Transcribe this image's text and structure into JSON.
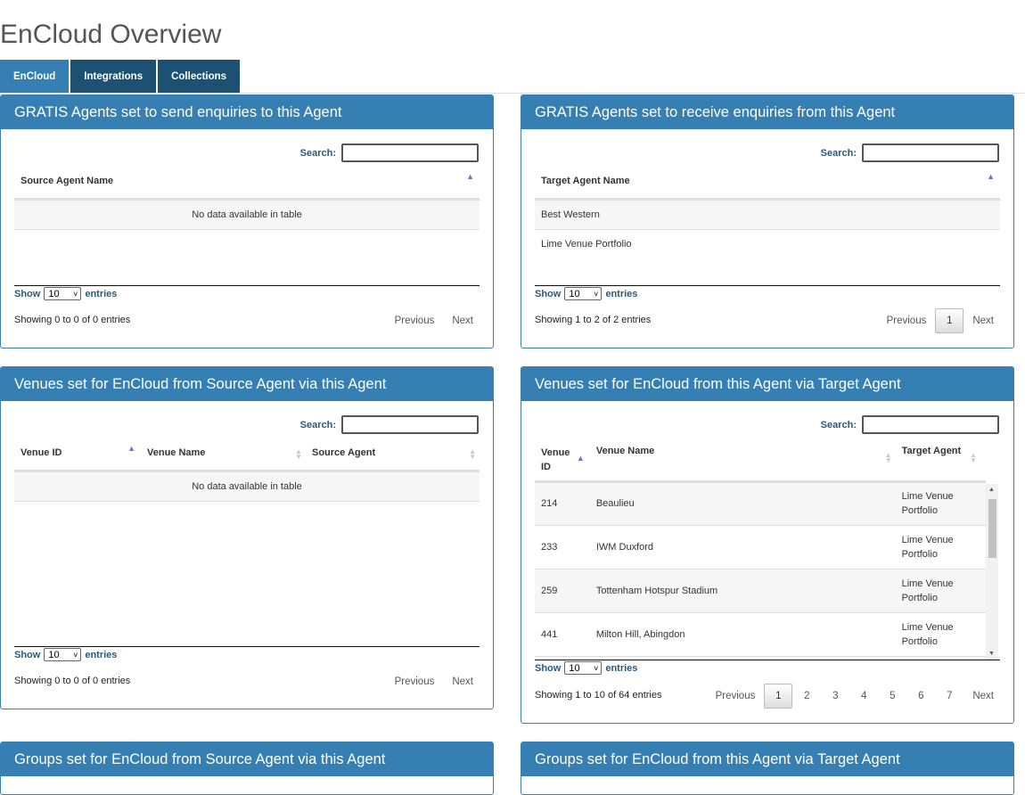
{
  "title": "EnCloud Overview",
  "tabs": [
    "EnCloud",
    "Integrations",
    "Collections"
  ],
  "common": {
    "search_label": "Search:",
    "show_label": "Show",
    "entries_label": "entries",
    "page_size": "10",
    "previous": "Previous",
    "next": "Next",
    "no_data": "No data available in table"
  },
  "panels": {
    "send": {
      "title": "GRATIS Agents set to send enquiries to this Agent",
      "col1": "Source Agent Name",
      "info": "Showing 0 to 0 of 0 entries"
    },
    "receive": {
      "title": "GRATIS Agents set to receive enquiries from this Agent",
      "col1": "Target Agent Name",
      "rows": [
        "Best Western",
        "Lime Venue Portfolio"
      ],
      "info": "Showing 1 to 2 of 2 entries",
      "page": "1"
    },
    "venues_source": {
      "title": "Venues set for EnCloud from Source Agent via this Agent",
      "cols": [
        "Venue ID",
        "Venue Name",
        "Source Agent"
      ],
      "info": "Showing 0 to 0 of 0 entries"
    },
    "venues_target": {
      "title": "Venues set for EnCloud from this Agent via Target Agent",
      "cols": [
        "Venue ID",
        "Venue Name",
        "Target Agent"
      ],
      "rows": [
        {
          "id": "214",
          "name": "Beaulieu",
          "agent": "Lime Venue Portfolio"
        },
        {
          "id": "233",
          "name": "IWM Duxford",
          "agent": "Lime Venue Portfolio"
        },
        {
          "id": "259",
          "name": "Tottenham Hotspur Stadium",
          "agent": "Lime Venue Portfolio"
        },
        {
          "id": "441",
          "name": "Milton Hill, Abingdon",
          "agent": "Lime Venue Portfolio"
        }
      ],
      "info": "Showing 1 to 10 of 64 entries",
      "pages": [
        "1",
        "2",
        "3",
        "4",
        "5",
        "6",
        "7"
      ]
    },
    "groups_source": {
      "title": "Groups set for EnCloud from Source Agent via this Agent"
    },
    "groups_target": {
      "title": "Groups set for EnCloud from this Agent via Target Agent"
    }
  }
}
